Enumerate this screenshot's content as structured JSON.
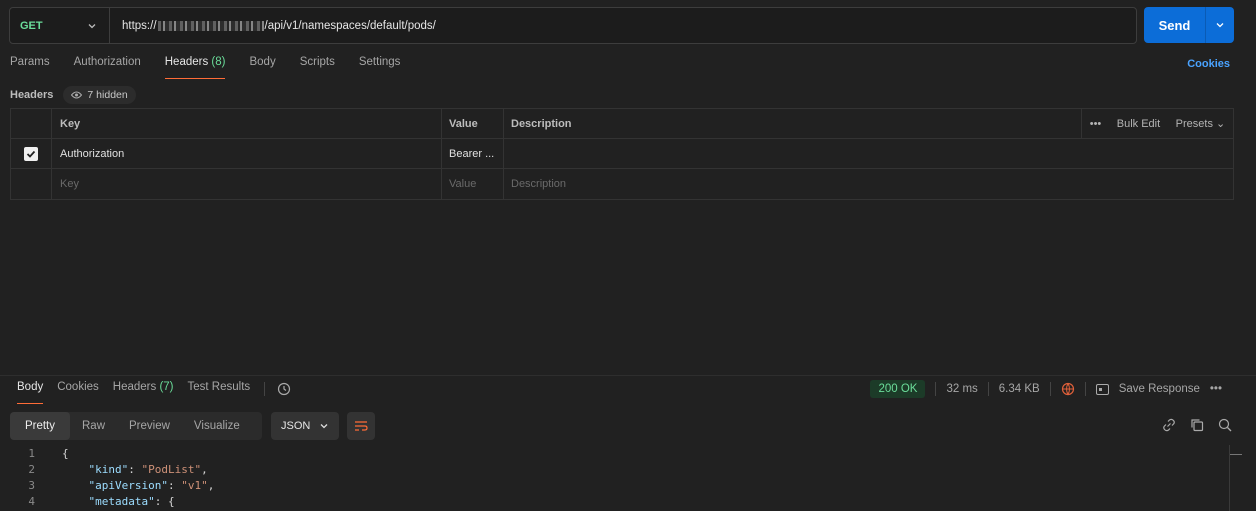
{
  "request": {
    "method": "GET",
    "url_prefix": "https://",
    "url_suffix": "/api/v1/namespaces/default/pods/",
    "send_label": "Send"
  },
  "request_tabs": [
    {
      "label": "Params",
      "count": ""
    },
    {
      "label": "Authorization",
      "count": ""
    },
    {
      "label": "Headers",
      "count": "(8)"
    },
    {
      "label": "Body",
      "count": ""
    },
    {
      "label": "Scripts",
      "count": ""
    },
    {
      "label": "Settings",
      "count": ""
    }
  ],
  "cookies_link": "Cookies",
  "headers_section": {
    "title": "Headers",
    "hidden_label": "7 hidden",
    "columns": {
      "key": "Key",
      "value": "Value",
      "description": "Description"
    },
    "bulk_edit": "Bulk Edit",
    "presets": "Presets",
    "row": {
      "key": "Authorization",
      "value": "Bearer ...",
      "description": ""
    },
    "placeholder": {
      "key": "Key",
      "value": "Value",
      "description": "Description"
    }
  },
  "response_tabs": [
    {
      "label": "Body",
      "count": ""
    },
    {
      "label": "Cookies",
      "count": ""
    },
    {
      "label": "Headers",
      "count": "(7)"
    },
    {
      "label": "Test Results",
      "count": ""
    }
  ],
  "response_meta": {
    "status": "200 OK",
    "time": "32 ms",
    "size": "6.34 KB",
    "save_label": "Save Response"
  },
  "view_modes": [
    "Pretty",
    "Raw",
    "Preview",
    "Visualize"
  ],
  "format": "JSON",
  "code_lines": [
    {
      "n": "1",
      "text": "{"
    },
    {
      "n": "2",
      "key": "\"kind\"",
      "sep": ": ",
      "val": "\"PodList\"",
      "end": ","
    },
    {
      "n": "3",
      "key": "\"apiVersion\"",
      "sep": ": ",
      "val": "\"v1\"",
      "end": ","
    },
    {
      "n": "4",
      "key": "\"metadata\"",
      "sep": ": {",
      "val": "",
      "end": ""
    }
  ],
  "colors": {
    "accent": "#ff6c37",
    "send": "#0c6dd8",
    "method": "#6bdd9a"
  }
}
